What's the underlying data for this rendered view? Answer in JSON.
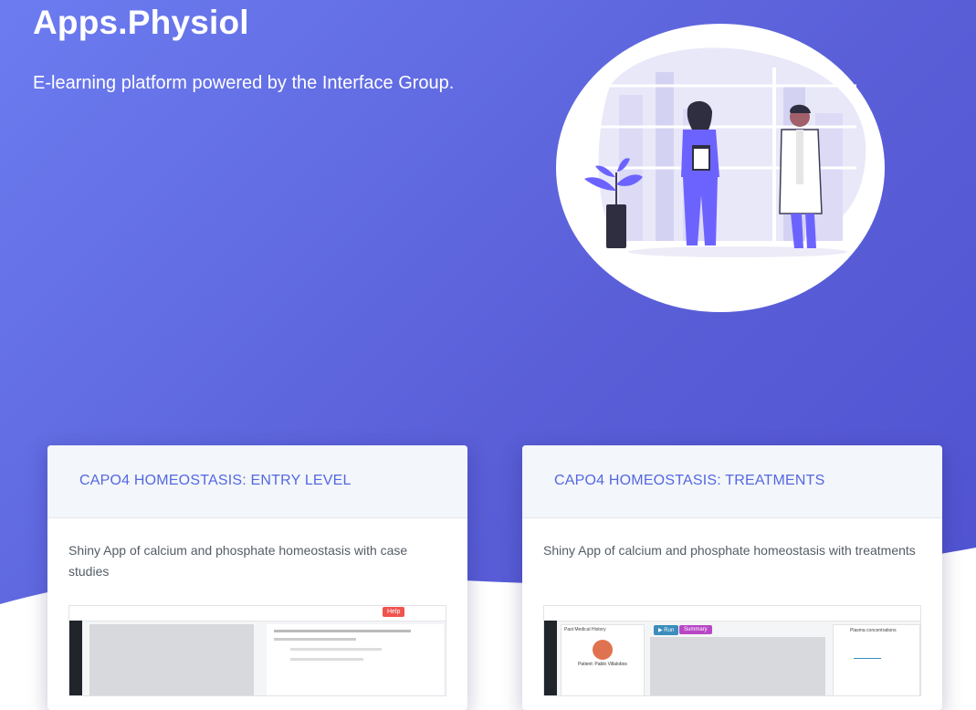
{
  "header": {
    "title": "Apps.Physiol",
    "subtitle": "E-learning platform powered by the Interface Group."
  },
  "cards": [
    {
      "title": "CAPO4 HOMEOSTASIS: ENTRY LEVEL",
      "description": "Shiny App of calcium and phosphate homeostasis with case studies",
      "preview": {
        "help_label": "Help"
      }
    },
    {
      "title": "CAPO4 HOMEOSTASIS: TREATMENTS",
      "description": "Shiny App of calcium and phosphate homeostasis with treatments",
      "preview": {
        "run_label": "▶ Run",
        "summary_label": "Summary",
        "panel_history": "Past Medical History",
        "patient_label": "Patient: Pablo Villalobos",
        "panel_plasma": "Plasma concentrations"
      }
    }
  ],
  "colors": {
    "hero_start": "#6c7cf0",
    "hero_end": "#4f51cf",
    "card_title": "#5468e0",
    "illustration_accent": "#6c63ff"
  },
  "icons": [
    "doctor-illustration",
    "plant-illustration"
  ]
}
